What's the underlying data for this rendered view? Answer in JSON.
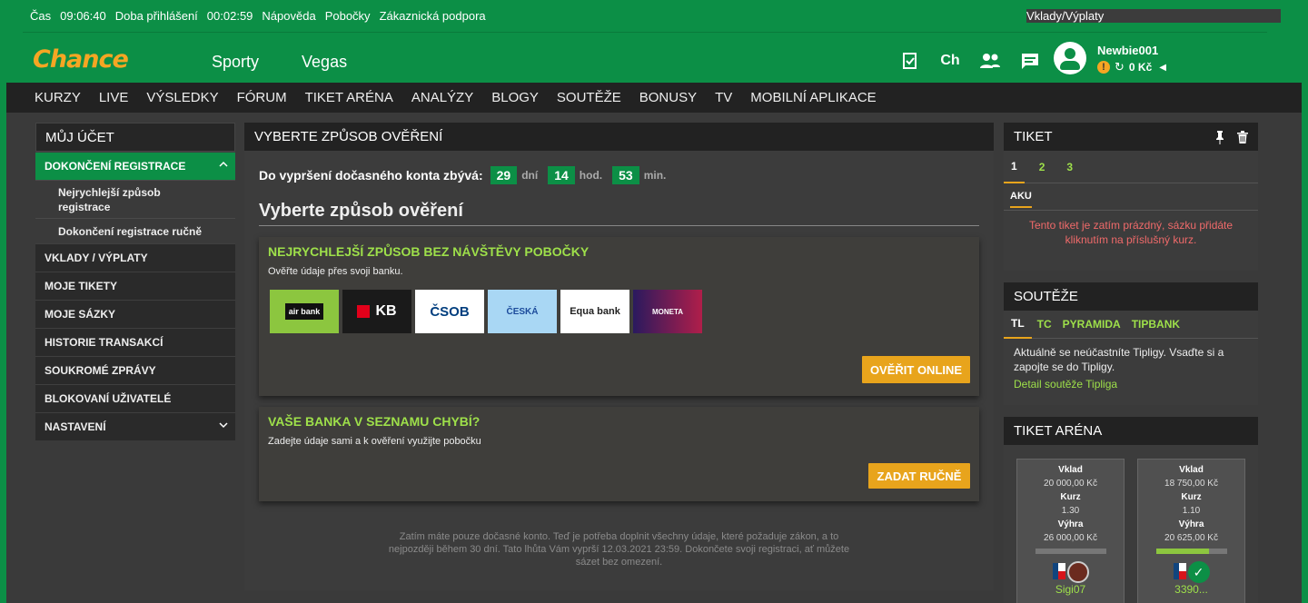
{
  "topbar": {
    "time_label": "Čas",
    "time_value": "09:06:40",
    "login_label": "Doba přihlášení",
    "login_value": "00:02:59",
    "help": "Nápověda",
    "branches": "Pobočky",
    "support": "Zákaznická podpora",
    "deposits": "Vklady/Výplaty"
  },
  "brand": "Chance",
  "mainnav": [
    "Sporty",
    "Vegas"
  ],
  "user": {
    "name": "Newbie001",
    "balance": "0 Kč"
  },
  "navbar": [
    "KURZY",
    "LIVE",
    "VÝSLEDKY",
    "FÓRUM",
    "TIKET ARÉNA",
    "ANALÝZY",
    "BLOGY",
    "SOUTĚŽE",
    "BONUSY",
    "TV",
    "MOBILNÍ APLIKACE"
  ],
  "account": {
    "title": "MŮJ ÚČET",
    "active": "DOKONČENÍ REGISTRACE",
    "sub1": "Nejrychlejší způsob registrace",
    "sub2": "Dokončení registrace ručně",
    "items": [
      "VKLADY / VÝPLATY",
      "MOJE TIKETY",
      "MOJE SÁZKY",
      "HISTORIE TRANSAKCÍ",
      "SOUKROMÉ ZPRÁVY",
      "BLOKOVANÍ UŽIVATELÉ",
      "NASTAVENÍ"
    ]
  },
  "verify": {
    "header": "VYBERTE ZPŮSOB OVĚŘENÍ",
    "timer_label": "Do vypršení dočasného konta zbývá:",
    "days": "29",
    "days_unit": "dní",
    "hours": "14",
    "hours_unit": "hod.",
    "mins": "53",
    "mins_unit": "min.",
    "title": "Vyberte způsob ověření",
    "card1_title": "NEJRYCHLEJŠÍ ZPŮSOB BEZ NÁVŠTĚVY POBOČKY",
    "card1_sub": "Ověřte údaje přes svoji banku.",
    "banks": [
      "air bank",
      "KB",
      "ČSOB",
      "ČESKÁ",
      "Equa bank",
      "MONETA"
    ],
    "verify_btn": "OVĚŘIT ONLINE",
    "card2_title": "VAŠE BANKA V SEZNAMU CHYBÍ?",
    "card2_sub": "Zadejte údaje sami a k ověření využijte pobočku",
    "manual_btn": "ZADAT RUČNĚ",
    "footer": "Zatím máte pouze dočasné konto. Teď je potřeba doplnit všechny údaje, které požaduje zákon, a to nejpozději během 30 dní. Tato lhůta Vám vyprší 12.03.2021 23:59. Dokončete svoji registraci, ať můžete sázet bez omezení."
  },
  "ticket": {
    "title": "TIKET",
    "tabs": [
      "1",
      "2",
      "3"
    ],
    "aku": "AKU",
    "empty": "Tento tiket je zatím prázdný, sázku přidáte kliknutím na příslušný kurz."
  },
  "contests": {
    "title": "SOUTĚŽE",
    "tabs": [
      "TL",
      "TC",
      "PYRAMIDA",
      "TIPBANK"
    ],
    "text": "Aktuálně se neúčastníte Tipligy. Vsaďte si a zapojte se do Tipligy.",
    "link": "Detail soutěže Tipliga"
  },
  "arena": {
    "title": "TIKET ARÉNA",
    "cols": [
      {
        "stake_label": "Vklad",
        "stake": "20 000,00 Kč",
        "odds_label": "Kurz",
        "odds": "1.30",
        "win_label": "Výhra",
        "win": "26 000,00 Kč",
        "progress": 0,
        "user": "Sigi07"
      },
      {
        "stake_label": "Vklad",
        "stake": "18 750,00 Kč",
        "odds_label": "Kurz",
        "odds": "1.10",
        "win_label": "Výhra",
        "win": "20 625,00 Kč",
        "progress": 0.75,
        "user": "3390..."
      }
    ]
  },
  "colors": {
    "brand_green": "#0c8f46",
    "accent_orange": "#e8a41c",
    "link_green": "#9ee04a"
  }
}
